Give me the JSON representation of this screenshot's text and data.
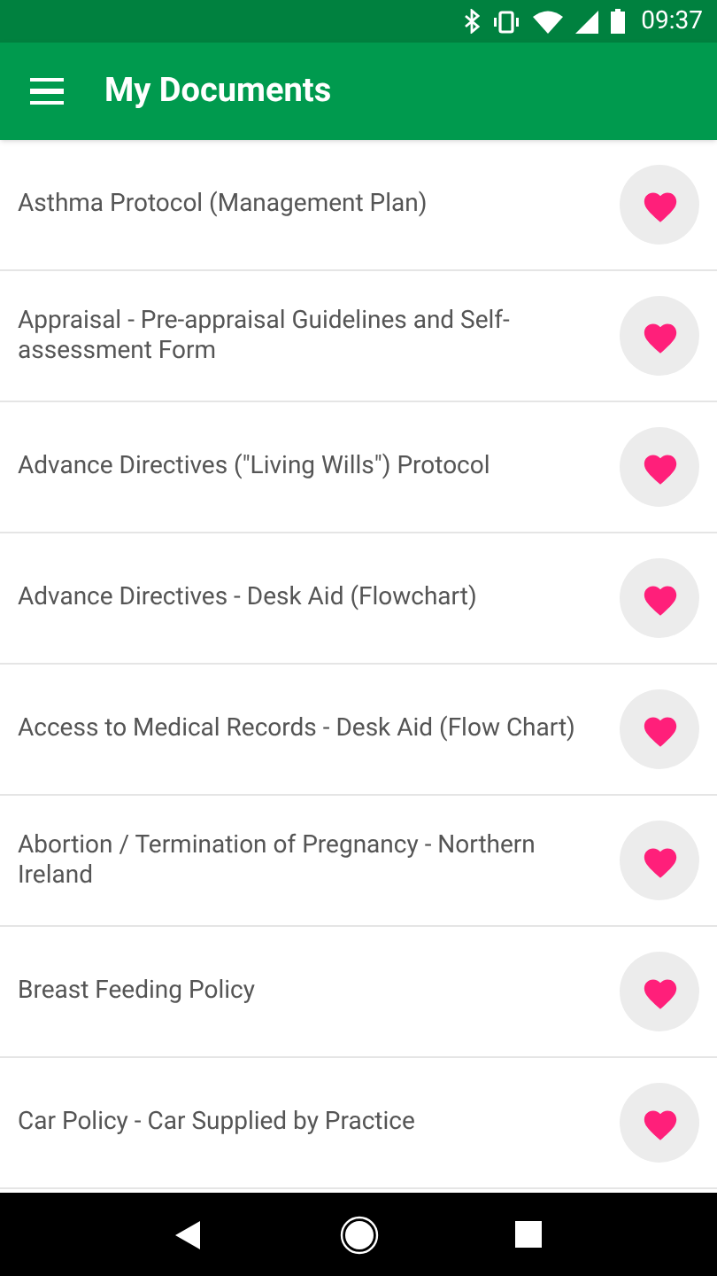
{
  "status_bar": {
    "time": "09:37"
  },
  "app_bar": {
    "title": "My Documents"
  },
  "documents": [
    {
      "title": "Asthma Protocol (Management Plan)",
      "favorite": true
    },
    {
      "title": "Appraisal - Pre-appraisal Guidelines and Self-assessment Form",
      "favorite": true
    },
    {
      "title": "Advance Directives (\"Living Wills\") Protocol",
      "favorite": true
    },
    {
      "title": "Advance Directives - Desk Aid (Flowchart)",
      "favorite": true
    },
    {
      "title": "Access to Medical Records - Desk Aid (Flow Chart)",
      "favorite": true
    },
    {
      "title": "Abortion / Termination of Pregnancy - Northern Ireland",
      "favorite": true
    },
    {
      "title": "Breast Feeding Policy",
      "favorite": true
    },
    {
      "title": "Car Policy - Car Supplied by Practice",
      "favorite": true
    }
  ]
}
